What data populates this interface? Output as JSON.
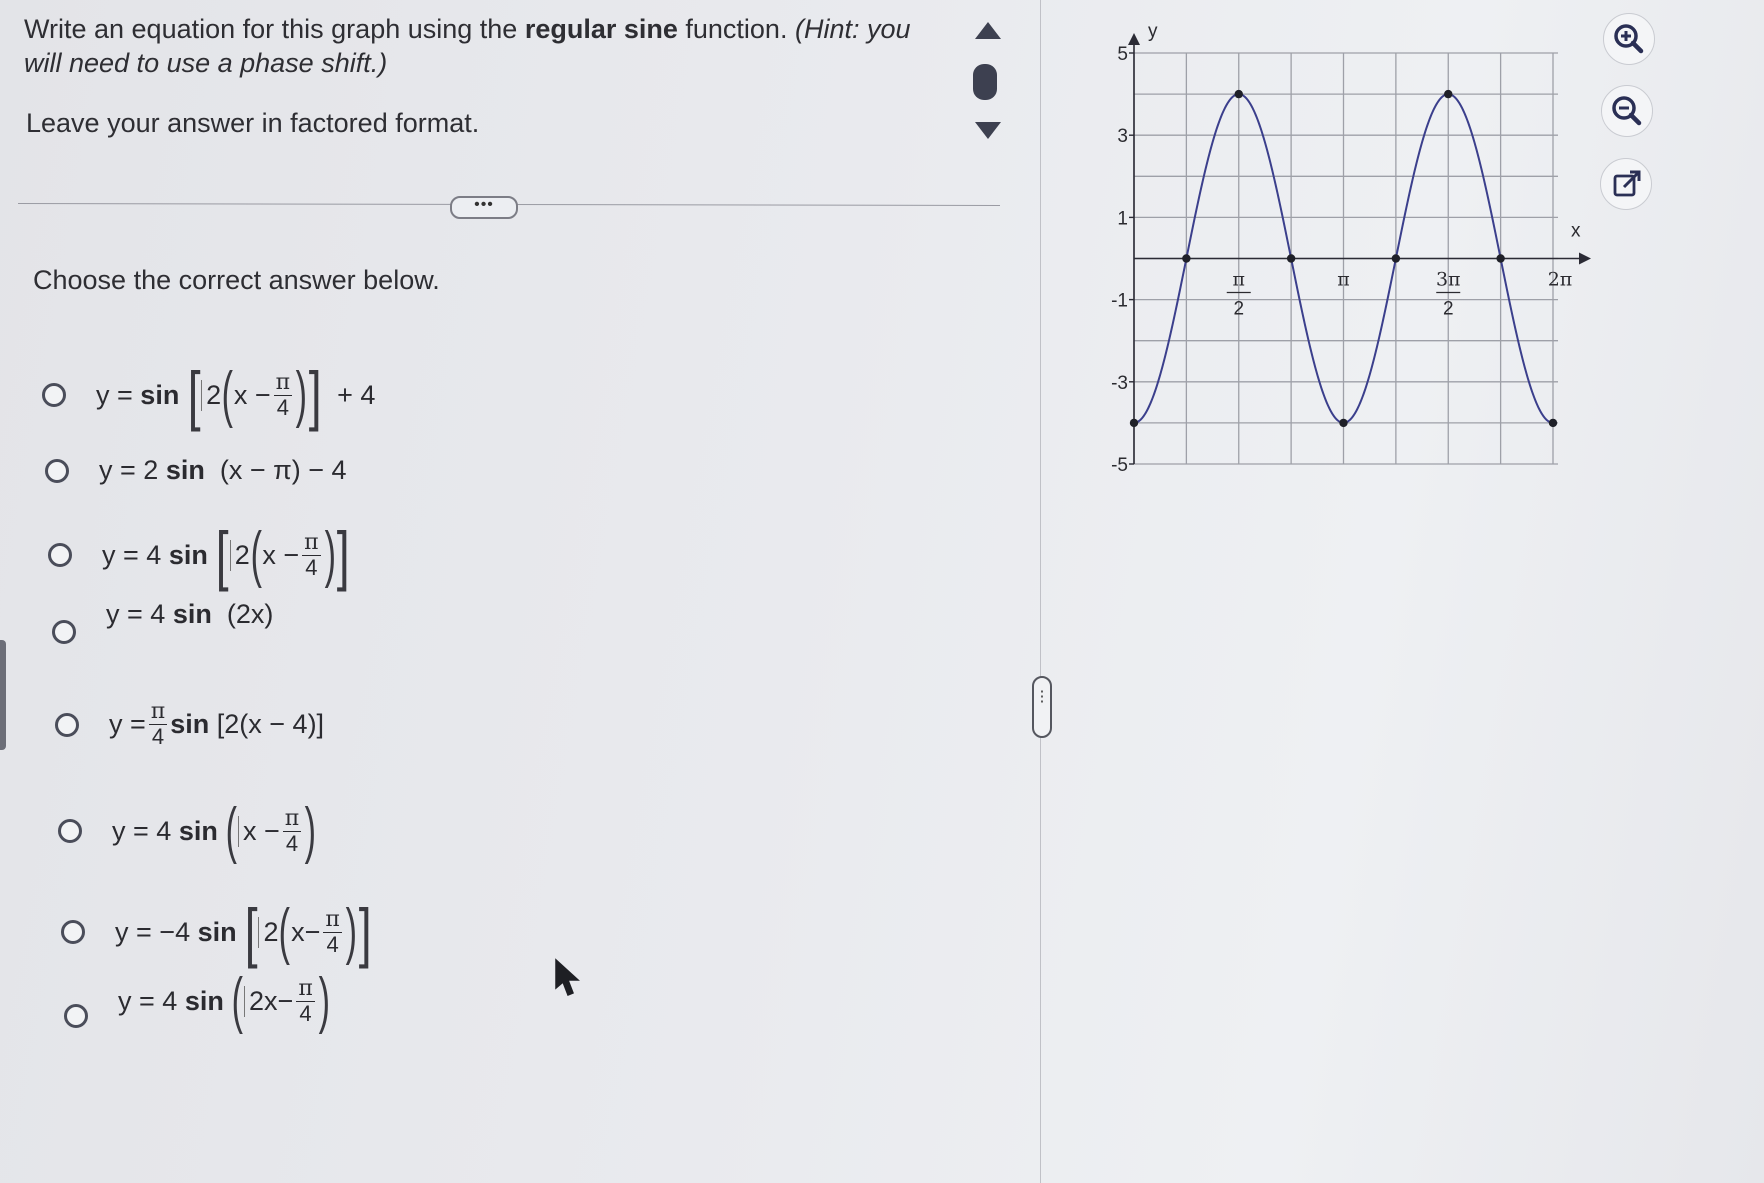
{
  "question": {
    "prompt_part1": "Write an equation for this graph using the ",
    "prompt_bold": "regular sine",
    "prompt_part2": " function.",
    "prompt_hint": "(Hint: you will need to use a phase shift.)",
    "instruction": "Leave your answer in factored format."
  },
  "more_button_label": "•••",
  "choose_label": "Choose the correct answer below.",
  "options": [
    {
      "id": "a",
      "text": "y = sin [2(x − π/4)] + 4"
    },
    {
      "id": "b",
      "text": "y = 2 sin (x − π) − 4"
    },
    {
      "id": "c",
      "text": "y = 4 sin [2(x − π/4)]"
    },
    {
      "id": "d",
      "text": "y = 4 sin (2x)"
    },
    {
      "id": "e",
      "text": "y = π/4 sin [2(x − 4)]"
    },
    {
      "id": "f",
      "text": "y = 4 sin (x − π/4)"
    },
    {
      "id": "g",
      "text": "y = −4 sin [2(x − π/4)]"
    },
    {
      "id": "h",
      "text": "y = 4 sin (2x − π/4)"
    }
  ],
  "math": {
    "y_eq": "y =",
    "sin": "sin",
    "bsin": " sin ",
    "two": "2",
    "x": "x",
    "minus": "−",
    "pi": "π",
    "four": "4",
    "plus4": "+ 4",
    "optb_tail": " (x − π) − 4",
    "optd_tail": " (2x)",
    "opte_tail": " [2(x − 4)]",
    "two_x": "2x",
    "coef_4": "4",
    "coef_2": "2",
    "coef_neg4": "−4"
  },
  "graph": {
    "y_axis_label": "y",
    "x_axis_label": "x",
    "y_ticks": [
      "5",
      "3",
      "1",
      "-1",
      "-3",
      "-5"
    ],
    "x_ticks": [
      {
        "num": "π",
        "den": "2"
      },
      {
        "num": "π",
        "den": ""
      },
      {
        "num": "3π",
        "den": "2"
      },
      {
        "num": "2π",
        "den": ""
      }
    ]
  },
  "chart_data": {
    "type": "line",
    "title": "",
    "xlabel": "x",
    "ylabel": "y",
    "xlim": [
      0,
      6.2832
    ],
    "ylim": [
      -5,
      5
    ],
    "grid": true,
    "function": "4 sin(2(x - π/4))",
    "key_points": [
      {
        "x": 0,
        "y": -4
      },
      {
        "x": 0.7854,
        "y": 0
      },
      {
        "x": 1.5708,
        "y": 4
      },
      {
        "x": 2.3562,
        "y": 0
      },
      {
        "x": 3.1416,
        "y": -4
      },
      {
        "x": 3.927,
        "y": 0
      },
      {
        "x": 4.7124,
        "y": 4
      },
      {
        "x": 5.4978,
        "y": 0
      },
      {
        "x": 6.2832,
        "y": -4
      }
    ],
    "series": [
      {
        "color": "#3b3f8c"
      }
    ]
  },
  "tools": {
    "zoom_in": "zoom-in-icon",
    "zoom_out": "zoom-out-icon",
    "popout": "external-link-icon"
  }
}
